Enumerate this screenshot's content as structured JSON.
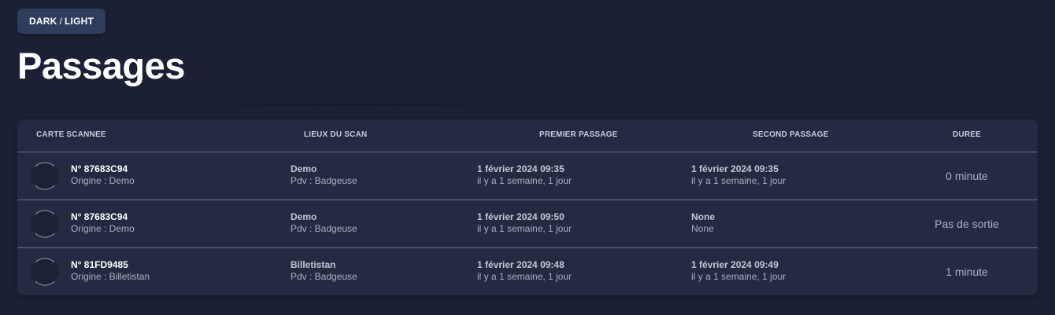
{
  "toggle": {
    "dark_label": "DARK",
    "separator": "/",
    "light_label": "LIGHT"
  },
  "page_title": "Passages",
  "table": {
    "headers": {
      "carte": "CARTE SCANNEE",
      "lieux": "LIEUX DU SCAN",
      "premier": "PREMIER PASSAGE",
      "second": "SECOND PASSAGE",
      "duree": "DUREE"
    },
    "rows": [
      {
        "card_number": "N° 87683C94",
        "origin": "Origine : Demo",
        "place": "Demo",
        "pdv": "Pdv : Badgeuse",
        "first_date": "1 février 2024 09:35",
        "first_ago": "il y a 1 semaine, 1 jour",
        "second_date": "1 février 2024 09:35",
        "second_ago": "il y a 1 semaine, 1 jour",
        "duration": "0 minute"
      },
      {
        "card_number": "N° 87683C94",
        "origin": "Origine : Demo",
        "place": "Demo",
        "pdv": "Pdv : Badgeuse",
        "first_date": "1 février 2024 09:50",
        "first_ago": "il y a 1 semaine, 1 jour",
        "second_date": "None",
        "second_ago": "None",
        "duration": "Pas de sortie"
      },
      {
        "card_number": "N° 81FD9485",
        "origin": "Origine : Billetistan",
        "place": "Billetistan",
        "pdv": "Pdv : Badgeuse",
        "first_date": "1 février 2024 09:48",
        "first_ago": "il y a 1 semaine, 1 jour",
        "second_date": "1 février 2024 09:49",
        "second_ago": "il y a 1 semaine, 1 jour",
        "duration": "1 minute"
      }
    ]
  },
  "colors": {
    "background": "#1b2035",
    "card": "#232a42",
    "button": "#2f3c5c",
    "divider": "#6b7390"
  }
}
